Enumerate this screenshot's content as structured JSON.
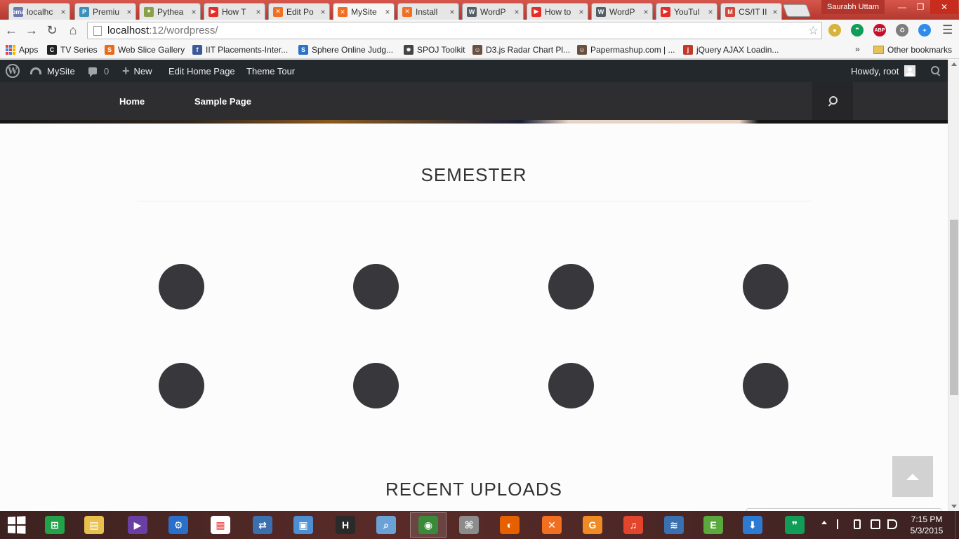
{
  "browser": {
    "tabs": [
      {
        "title": "localhc",
        "icon": "phpmyadmin-icon",
        "color": "#6c78af",
        "glyph": "pma"
      },
      {
        "title": "Premiu",
        "icon": "premium-icon",
        "color": "#3b8fb8",
        "glyph": "P"
      },
      {
        "title": "Pythea",
        "icon": "puzzle-icon",
        "color": "#8aa04a",
        "glyph": "✦"
      },
      {
        "title": "How T",
        "icon": "youtube-icon",
        "color": "#e52d27",
        "glyph": "▶"
      },
      {
        "title": "Edit Po",
        "icon": "xampp-icon",
        "color": "#f26f21",
        "glyph": "✕"
      },
      {
        "title": "MySite",
        "icon": "xampp-icon",
        "color": "#f26f21",
        "glyph": "✕"
      },
      {
        "title": "Install",
        "icon": "xampp-icon",
        "color": "#f26f21",
        "glyph": "✕"
      },
      {
        "title": "WordP",
        "icon": "wordpress-icon",
        "color": "#555d66",
        "glyph": "W"
      },
      {
        "title": "How to",
        "icon": "youtube-icon",
        "color": "#e52d27",
        "glyph": "▶"
      },
      {
        "title": "WordP",
        "icon": "wordpress-icon",
        "color": "#555d66",
        "glyph": "W"
      },
      {
        "title": "YouTul",
        "icon": "youtube-icon",
        "color": "#e52d27",
        "glyph": "▶"
      },
      {
        "title": "CS/IT II",
        "icon": "gmail-icon",
        "color": "#d44638",
        "glyph": "M"
      }
    ],
    "tab_close": "×",
    "profile_name": "Saurabh Uttam",
    "url_host": "localhost",
    "url_path": ":12/wordpress/",
    "extensions": [
      {
        "icon": "circle-extension-icon",
        "color": "#d6b33a",
        "glyph": "●"
      },
      {
        "icon": "hangouts-extension-icon",
        "color": "#0f9d58",
        "glyph": "❞"
      },
      {
        "icon": "adblock-plus-icon",
        "color": "#c70d2c",
        "glyph": "ABP"
      },
      {
        "icon": "recycle-icon",
        "color": "#7d7d7d",
        "glyph": "♻"
      },
      {
        "icon": "plus-extension-icon",
        "color": "#2d8ceb",
        "glyph": "+"
      }
    ],
    "bookmarks": [
      {
        "label": "Apps",
        "icon": "apps-icon",
        "color": "",
        "glyph": ""
      },
      {
        "label": "TV Series",
        "icon": "tv-series-icon",
        "color": "#222222",
        "glyph": "C"
      },
      {
        "label": "Web Slice Gallery",
        "icon": "web-slice-icon",
        "color": "#e96b1a",
        "glyph": "S"
      },
      {
        "label": "IIT Placements-Inter...",
        "icon": "facebook-icon",
        "color": "#3b5998",
        "glyph": "f"
      },
      {
        "label": "Sphere Online Judg...",
        "icon": "spoj-icon",
        "color": "#2a73c6",
        "glyph": "S"
      },
      {
        "label": "SPOJ Toolkit",
        "icon": "spoj-toolkit-icon",
        "color": "#444444",
        "glyph": "✹"
      },
      {
        "label": "D3.js Radar Chart Pl...",
        "icon": "d3-radar-icon",
        "color": "#6a5040",
        "glyph": "☺"
      },
      {
        "label": "Papermashup.com | ...",
        "icon": "papermashup-icon",
        "color": "#6a5040",
        "glyph": "☺"
      },
      {
        "label": "jQuery AJAX Loadin...",
        "icon": "jquery-icon",
        "color": "#c0392b",
        "glyph": "j"
      }
    ],
    "bookmarks_overflow": "»",
    "other_bookmarks": "Other bookmarks"
  },
  "wp_admin_bar": {
    "site_name": "MySite",
    "comments_count": "0",
    "new_label": "New",
    "edit_label": "Edit Home Page",
    "tour_label": "Theme Tour",
    "howdy": "Howdy, root"
  },
  "site_nav": {
    "items": [
      "Home",
      "Sample Page"
    ]
  },
  "main": {
    "semester_title": "SEMESTER",
    "semester_items": 8,
    "recent_uploads_title": "RECENT UPLOADS"
  },
  "taskbar": {
    "apps": [
      {
        "icon": "store-icon",
        "color": "#22a34a",
        "glyph": "⊞"
      },
      {
        "icon": "file-explorer-icon",
        "color": "#e9c04c",
        "glyph": "▤"
      },
      {
        "icon": "visual-studio-icon",
        "color": "#6a3fa4",
        "glyph": "▶"
      },
      {
        "icon": "bluetooth-transfer-icon",
        "color": "#2a6fc9",
        "glyph": "⚙"
      },
      {
        "icon": "apps-grid-icon",
        "color": "#ffffff",
        "glyph": "▦"
      },
      {
        "icon": "network-tool-icon",
        "color": "#3a6fb0",
        "glyph": "⇄"
      },
      {
        "icon": "remote-desktop-icon",
        "color": "#4d8fd2",
        "glyph": "▣"
      },
      {
        "icon": "h-app-icon",
        "color": "#2a2a2a",
        "glyph": "H"
      },
      {
        "icon": "search-tool-icon",
        "color": "#6aa2d6",
        "glyph": "⌕"
      },
      {
        "icon": "chrome-icon",
        "color": "#3a8a3a",
        "glyph": "◉"
      },
      {
        "icon": "map-tool-icon",
        "color": "#8c8c8c",
        "glyph": "⌘"
      },
      {
        "icon": "firefox-icon",
        "color": "#e66000",
        "glyph": "◐"
      },
      {
        "icon": "xampp-taskbar-icon",
        "color": "#f26f21",
        "glyph": "✕"
      },
      {
        "icon": "pdf-icon",
        "color": "#f08a24",
        "glyph": "G"
      },
      {
        "icon": "headphones-icon",
        "color": "#e3452c",
        "glyph": "♫"
      },
      {
        "icon": "wifi-hotspot-icon",
        "color": "#3a6fb0",
        "glyph": "≋"
      },
      {
        "icon": "evernote-icon",
        "color": "#5aa93c",
        "glyph": "E"
      },
      {
        "icon": "download-manager-icon",
        "color": "#2d7ad3",
        "glyph": "⬇"
      },
      {
        "icon": "hangouts-icon",
        "color": "#0f9d58",
        "glyph": "❞"
      }
    ],
    "active_app_index": 9,
    "time": "7:15 PM",
    "date": "5/3/2015"
  }
}
